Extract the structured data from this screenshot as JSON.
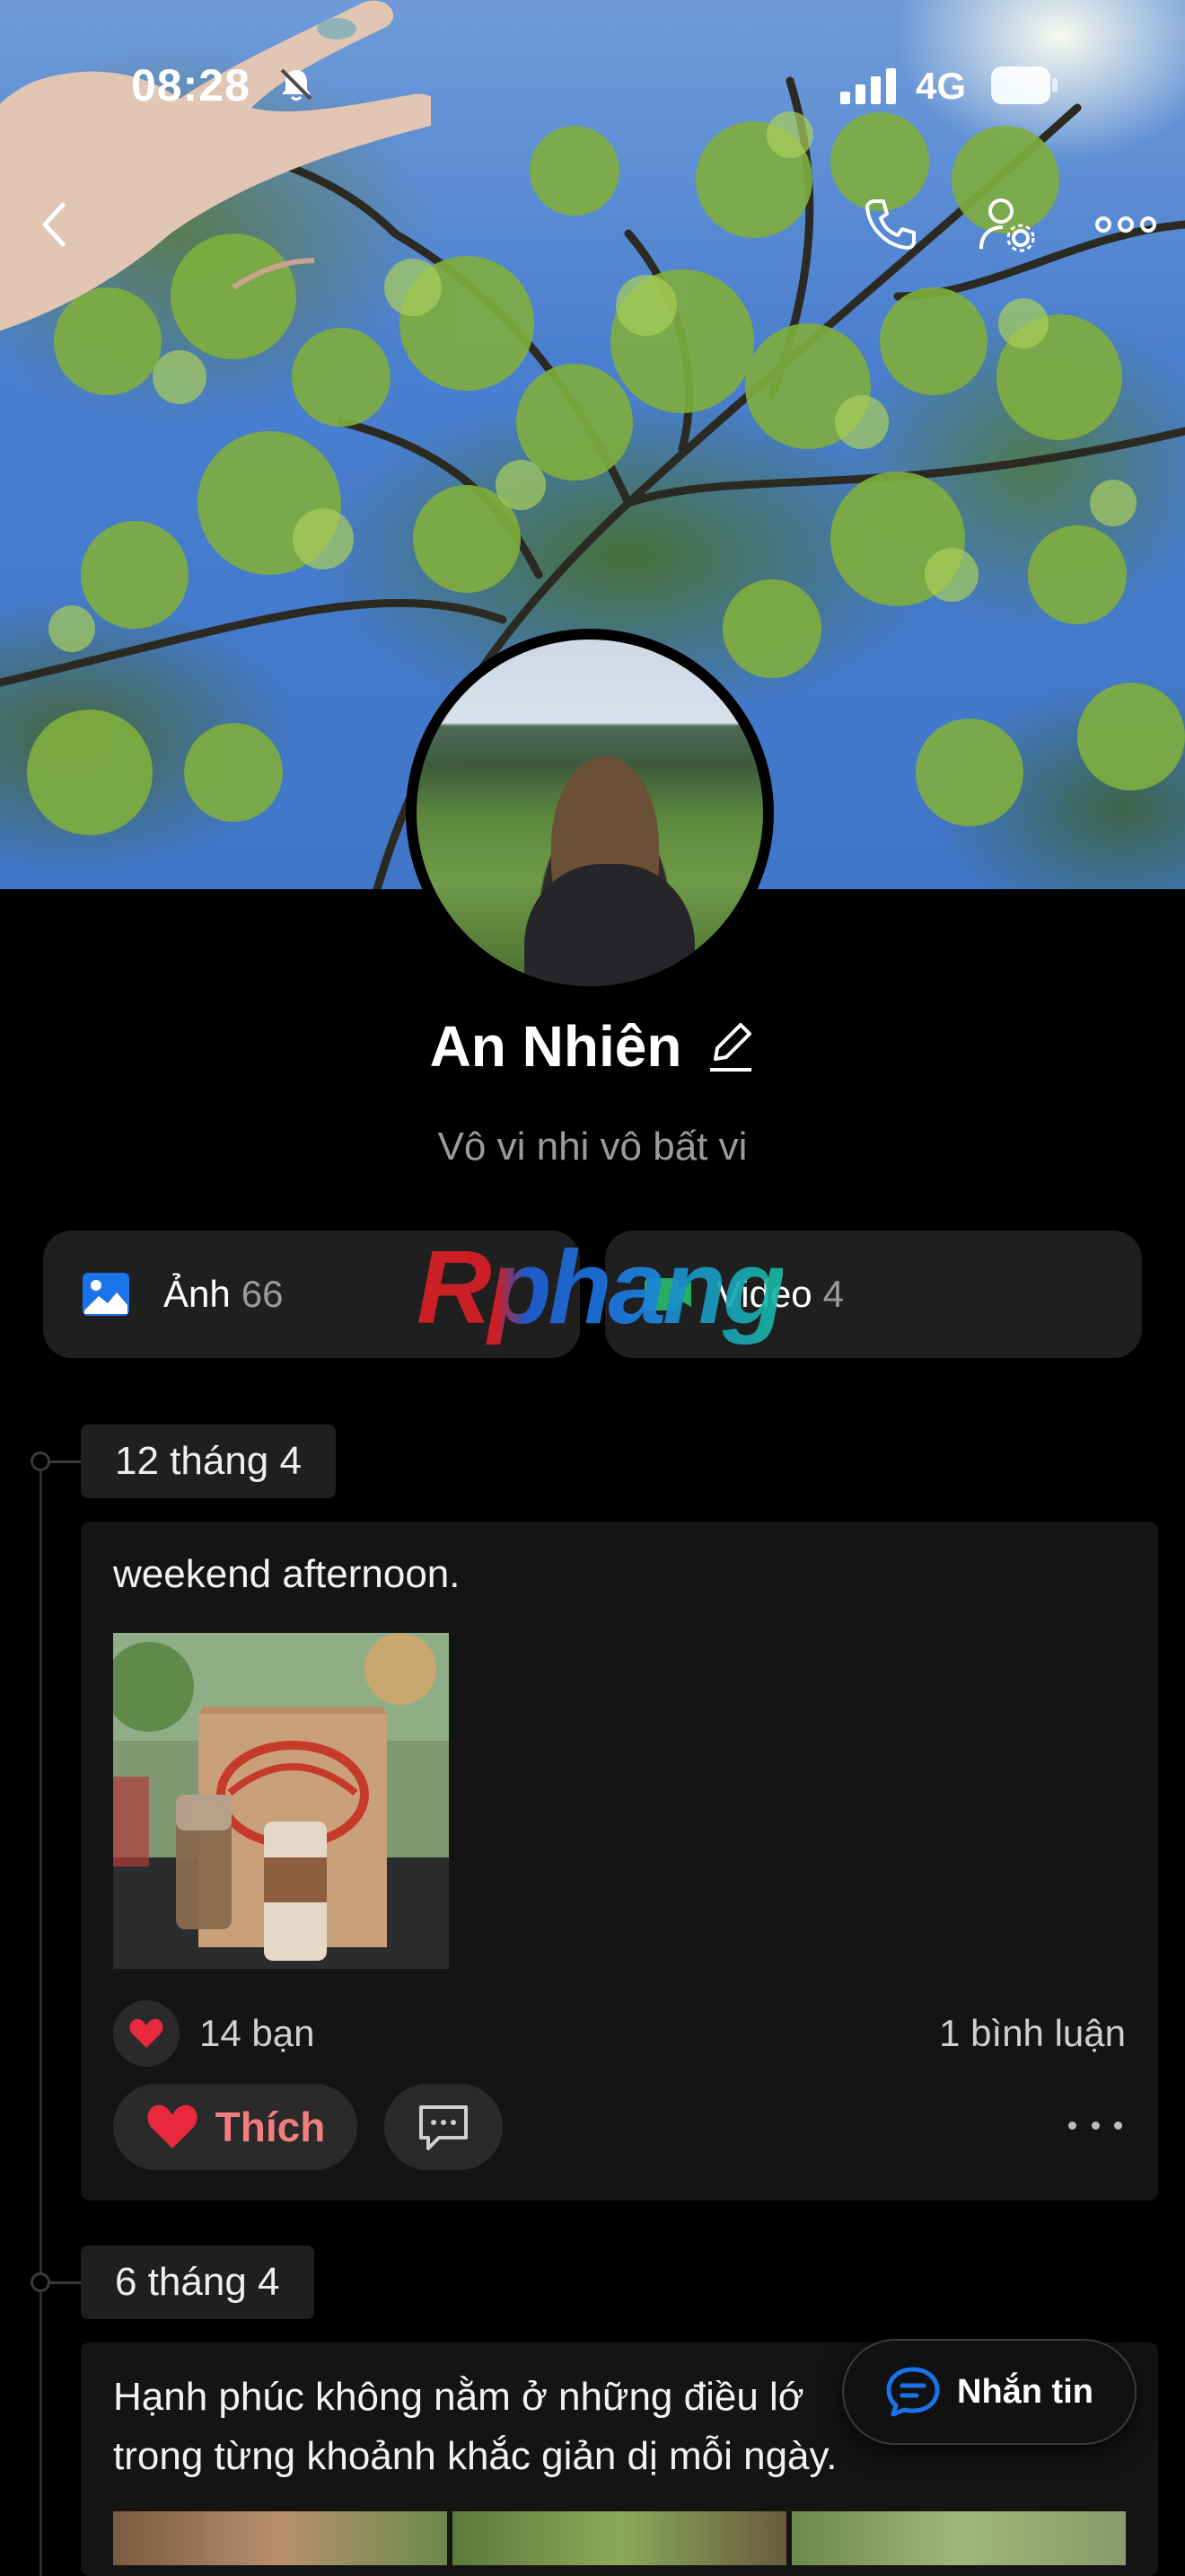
{
  "status_bar": {
    "time": "08:28",
    "network": "4G",
    "icons": [
      "bell-muted-icon",
      "cellular-signal-icon",
      "battery-icon"
    ]
  },
  "nav": {
    "icons": [
      "chevron-left-icon",
      "phone-icon",
      "user-settings-icon",
      "more-horizontal-icon"
    ]
  },
  "profile": {
    "name": "An Nhiên",
    "bio": "Vô vi nhi vô bất vi"
  },
  "media": {
    "photos_label": "Ảnh",
    "photos_count": "66",
    "videos_label": "Video",
    "videos_count": "4"
  },
  "watermark": "Rphang",
  "posts": [
    {
      "date": "12 tháng 4",
      "text": "weekend afternoon.",
      "reactions": "14 bạn",
      "comments": "1 bình luận",
      "like_label": "Thích"
    },
    {
      "date": "6 tháng 4",
      "text_line1": "Hạnh phúc không nằm ở những điều lớ",
      "text_line2": "trong từng khoảnh khắc giản dị mỗi ngày."
    }
  ],
  "floating": {
    "message_label": "Nhắn tin"
  },
  "colors": {
    "background": "#000000",
    "card": "#141414",
    "chip": "#1f1f1f",
    "accent_blue": "#1a73e8",
    "like_red": "#e8283c"
  }
}
